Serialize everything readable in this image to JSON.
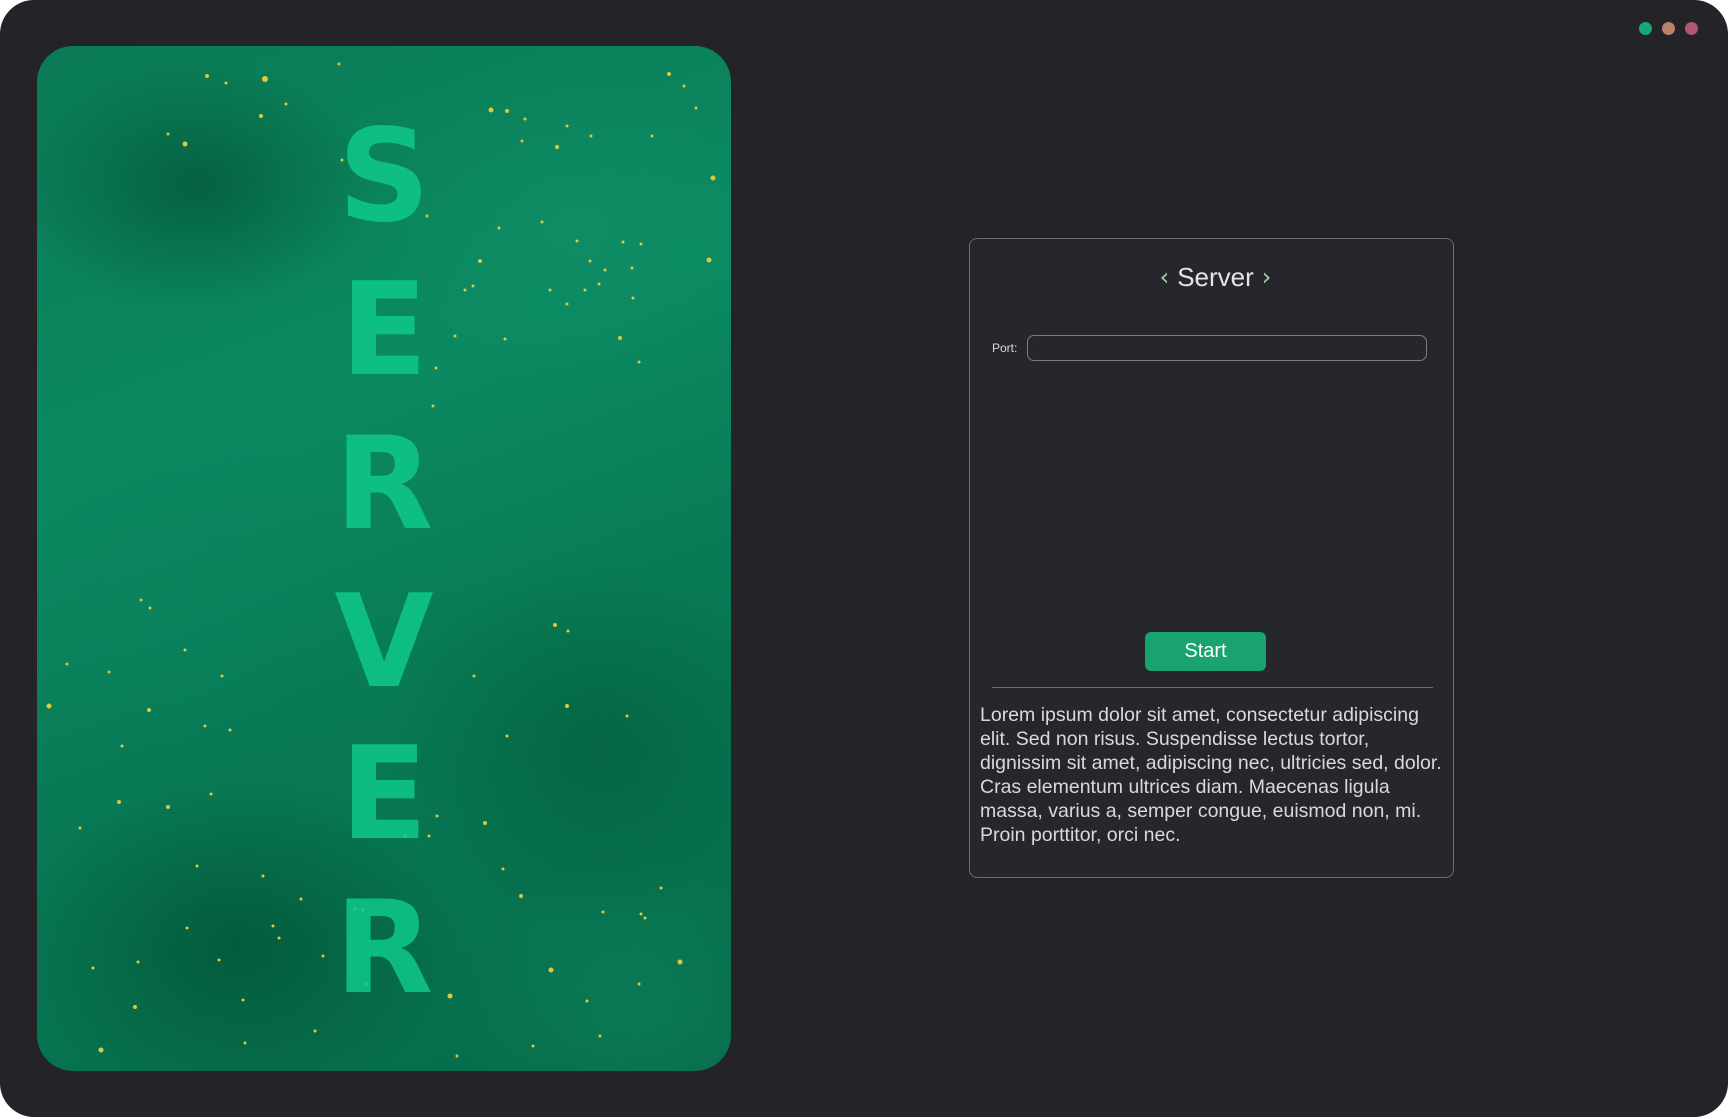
{
  "window": {
    "controls": [
      {
        "name": "green",
        "color": "#18a777"
      },
      {
        "name": "orange",
        "color": "#b8826b"
      },
      {
        "name": "red",
        "color": "#b25673"
      }
    ]
  },
  "hero": {
    "letters": [
      "S",
      "E",
      "R",
      "V",
      "E",
      "R"
    ],
    "letter_color": "#0fc98a",
    "background_color": "#0b8a61"
  },
  "panel": {
    "title": "Server",
    "prev_icon": "chevron-left-icon",
    "next_icon": "chevron-right-icon",
    "port_label": "Port:",
    "port_value": "",
    "port_placeholder": "",
    "start_label": "Start",
    "description": "Lorem ipsum dolor sit amet, consectetur adipiscing elit. Sed non risus. Suspendisse lectus tortor, dignissim sit amet, adipiscing nec, ultricies sed, dolor. Cras elementum ultrices diam. Maecenas ligula massa, varius a, semper congue, euismod non, mi. Proin porttitor, orci nec.",
    "accent_color": "#18a36f"
  }
}
